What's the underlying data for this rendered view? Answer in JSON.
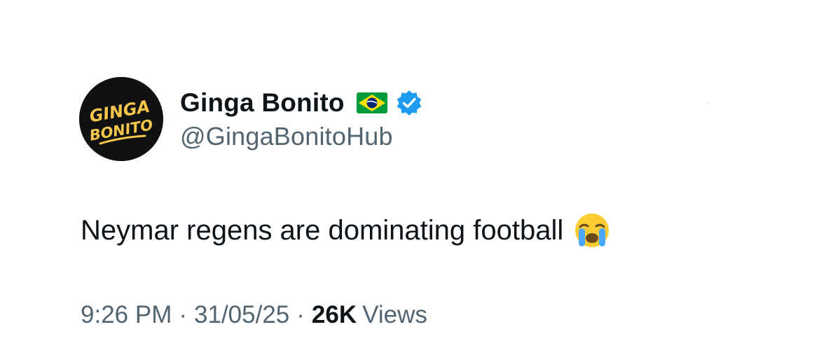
{
  "author": {
    "avatar_text_line1": "GINGA",
    "avatar_text_line2": "BONITO",
    "display_name": "Ginga Bonito",
    "flag_icon": "brazil-flag-emoji",
    "verified_icon": "verified-badge",
    "handle": "@GingaBonitoHub"
  },
  "tweet": {
    "text": "Neymar regens are dominating football",
    "emoji_icon": "loudly-crying-face-emoji"
  },
  "meta": {
    "time": "9:26 PM",
    "separator": "·",
    "date": "31/05/25",
    "views_count": "26K",
    "views_label": "Views"
  },
  "colors": {
    "text_primary": "#0f1419",
    "text_secondary": "#536471",
    "verified_blue": "#1d9bf0",
    "brazil_green": "#009c3b",
    "brazil_yellow": "#ffdf00",
    "brazil_blue": "#002776",
    "avatar_bg": "#111111",
    "avatar_text": "#f3c64b"
  }
}
